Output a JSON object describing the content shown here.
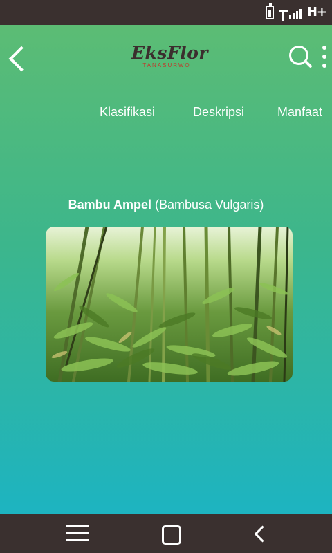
{
  "app": {
    "logo_main": "EksFlor",
    "logo_sub": "TANASURWO"
  },
  "status": {
    "network": "H+"
  },
  "tabs": [
    {
      "label": "Klasifikasi"
    },
    {
      "label": "Deskripsi"
    },
    {
      "label": "Manfaat"
    }
  ],
  "content": {
    "common_name": "Bambu Ampel",
    "scientific_name": "(Bambusa Vulgaris)"
  }
}
